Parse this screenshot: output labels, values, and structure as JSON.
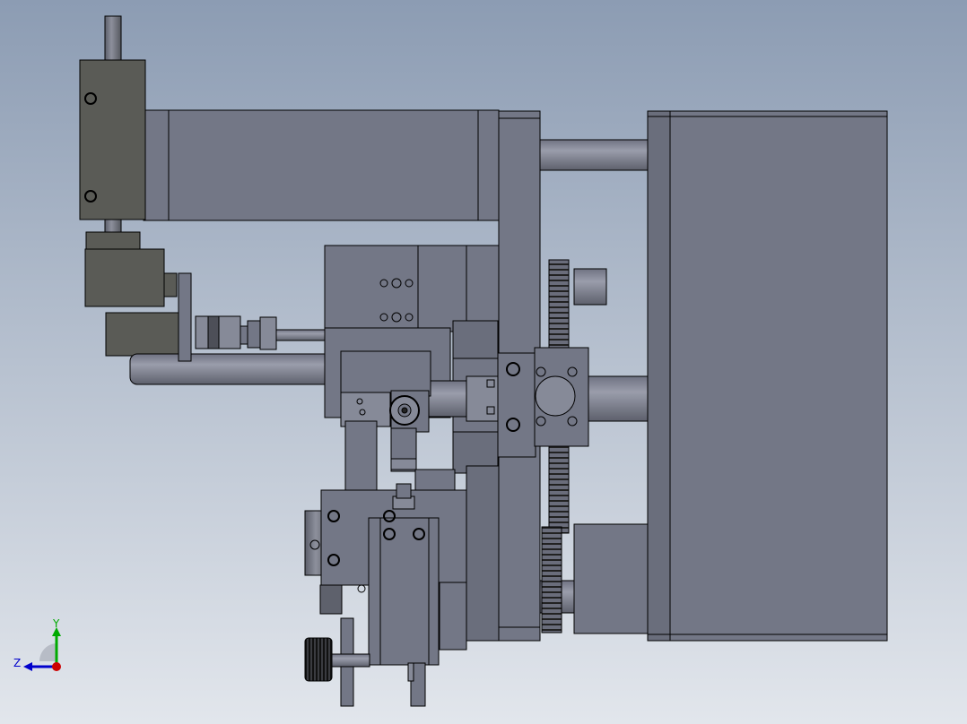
{
  "viewport": {
    "background_top": "#8c9cb3",
    "background_bottom": "#e2e6ec"
  },
  "colors": {
    "part_fill": "#737786",
    "part_dark": "#606470",
    "part_light": "#868a98",
    "edge": "#000000",
    "motor_fill": "#5a5b56",
    "axis_x": "#cc0000",
    "axis_y": "#00aa00",
    "axis_z": "#0000cc"
  },
  "triad": {
    "y_label": "Y",
    "z_label": "Z"
  }
}
